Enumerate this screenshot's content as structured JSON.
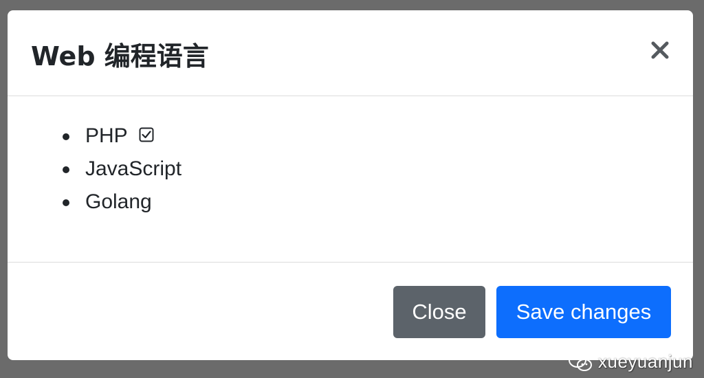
{
  "modal": {
    "title": "Web 编程语言",
    "close_icon": "close-x-icon",
    "languages": [
      {
        "label": "PHP",
        "checked": true
      },
      {
        "label": "JavaScript",
        "checked": false
      },
      {
        "label": "Golang",
        "checked": false
      }
    ],
    "footer": {
      "close_label": "Close",
      "save_label": "Save changes"
    }
  },
  "colors": {
    "primary": "#0d6efd",
    "secondary": "#5c636a",
    "backdrop": "#6b6b6b",
    "text": "#212529"
  },
  "watermark": {
    "text": "xueyuanjun",
    "icon": "wechat-icon"
  }
}
